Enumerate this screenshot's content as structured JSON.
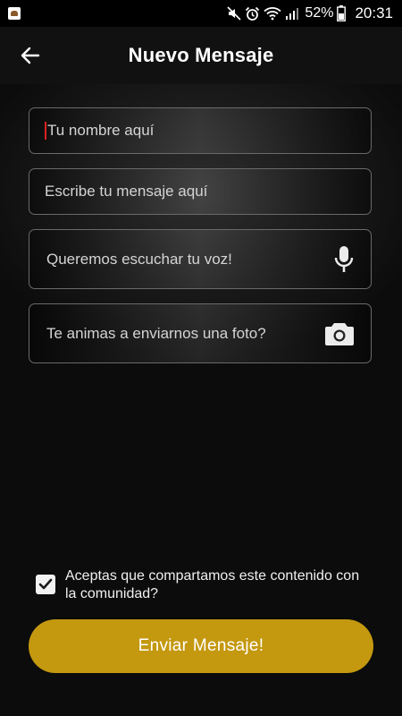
{
  "status_bar": {
    "battery_percent": "52%",
    "time": "20:31",
    "icons": [
      "app-notification-icon",
      "mute-icon",
      "alarm-icon",
      "wifi-icon",
      "signal-icon",
      "battery-icon"
    ]
  },
  "app_bar": {
    "back_icon": "arrow-left-icon",
    "title": "Nuevo Mensaje"
  },
  "form": {
    "name_placeholder": "Tu nombre aquí",
    "message_placeholder": "Escribe tu mensaje aquí",
    "voice_label": "Queremos escuchar tu voz!",
    "voice_icon": "microphone-icon",
    "photo_label": "Te animas a enviarnos una foto?",
    "photo_icon": "camera-icon"
  },
  "consent": {
    "checked": true,
    "label": "Aceptas que compartamos este contenido con la comunidad?"
  },
  "submit": {
    "label": "Enviar Mensaje!"
  },
  "colors": {
    "accent": "#c4980f",
    "background": "#0d0d0d",
    "field_border": "#6a6a6a",
    "cursor": "#e02020"
  }
}
